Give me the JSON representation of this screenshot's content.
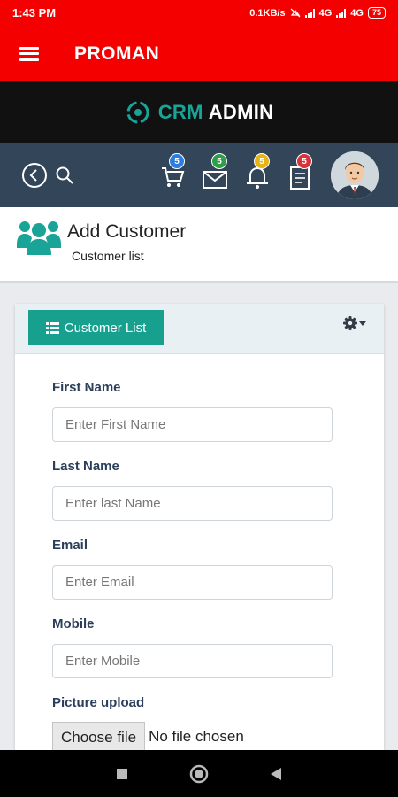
{
  "status": {
    "time": "1:43 PM",
    "speed": "0.1KB/s",
    "net1": "4G",
    "net2": "4G",
    "battery": "75"
  },
  "app": {
    "title": "PROMAN"
  },
  "brand": {
    "crm": "CRM",
    "admin": "ADMIN"
  },
  "toolbar": {
    "badges": [
      {
        "icon": "cart-icon",
        "count": "5",
        "color": "#2a7de1"
      },
      {
        "icon": "mail-icon",
        "count": "5",
        "color": "#2e9e4a"
      },
      {
        "icon": "bell-icon",
        "count": "5",
        "color": "#e7b416"
      },
      {
        "icon": "clipboard-icon",
        "count": "5",
        "color": "#d9323b"
      }
    ]
  },
  "page": {
    "title": "Add Customer",
    "subtitle": "Customer list"
  },
  "card": {
    "list_button": "Customer List"
  },
  "form": {
    "first_name": {
      "label": "First Name",
      "placeholder": "Enter First Name"
    },
    "last_name": {
      "label": "Last Name",
      "placeholder": "Enter last Name"
    },
    "email": {
      "label": "Email",
      "placeholder": "Enter Email"
    },
    "mobile": {
      "label": "Mobile",
      "placeholder": "Enter Mobile"
    },
    "picture": {
      "label": "Picture upload",
      "button": "Choose file",
      "status": "No file chosen"
    }
  },
  "colors": {
    "brand_red": "#f40000",
    "toolbar": "#334559",
    "accent": "#18a08f"
  }
}
